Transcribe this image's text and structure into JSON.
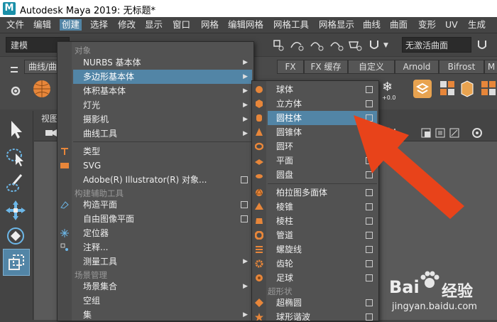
{
  "window": {
    "title": "Autodesk Maya 2019: 无标题*",
    "logo": "M"
  },
  "menubar": {
    "items": [
      "文件",
      "编辑",
      "创建",
      "选择",
      "修改",
      "显示",
      "窗口",
      "网格",
      "编辑网格",
      "网格工具",
      "网格显示",
      "曲线",
      "曲面",
      "变形",
      "UV",
      "生成"
    ],
    "active_index": 2
  },
  "shelf": {
    "mode_dropdown": "建模",
    "live_surface": "无激活曲面",
    "tabs": [
      "曲线/曲",
      "FX",
      "FX 缓存",
      "自定义",
      "Arnold",
      "Bifrost",
      "M"
    ]
  },
  "viewport": {
    "label": "视图"
  },
  "create_menu": {
    "sections": {
      "objects": "对象",
      "construction": "构建辅助工具",
      "scene": "场景管理"
    },
    "items": [
      {
        "label": "NURBS 基本体",
        "submenu": true
      },
      {
        "label": "多边形基本体",
        "submenu": true,
        "highlighted": true
      },
      {
        "label": "体积基本体",
        "submenu": true
      },
      {
        "label": "灯光",
        "submenu": true
      },
      {
        "label": "摄影机",
        "submenu": true
      },
      {
        "label": "曲线工具",
        "submenu": true
      },
      {
        "label": "类型"
      },
      {
        "label": "SVG"
      },
      {
        "label": "Adobe(R) Illustrator(R) 对象...",
        "option": true
      },
      {
        "label": "构造平面",
        "option": true
      },
      {
        "label": "自由图像平面",
        "option": true
      },
      {
        "label": "定位器"
      },
      {
        "label": "注释..."
      },
      {
        "label": "测量工具",
        "submenu": true
      },
      {
        "label": "场景集合",
        "submenu": true
      },
      {
        "label": "空组"
      },
      {
        "label": "集",
        "submenu": true
      }
    ]
  },
  "poly_menu": {
    "section_superellipse": "超形状",
    "items": [
      {
        "label": "球体",
        "icon": "sphere-icon"
      },
      {
        "label": "立方体",
        "icon": "cube-icon"
      },
      {
        "label": "圆柱体",
        "icon": "cylinder-icon",
        "highlighted": true
      },
      {
        "label": "圆锥体",
        "icon": "cone-icon"
      },
      {
        "label": "圆环",
        "icon": "torus-icon"
      },
      {
        "label": "平面",
        "icon": "plane-icon"
      },
      {
        "label": "圆盘",
        "icon": "disc-icon"
      },
      {
        "label": "柏拉图多面体",
        "icon": "platonic-icon"
      },
      {
        "label": "棱锥",
        "icon": "pyramid-icon"
      },
      {
        "label": "棱柱",
        "icon": "prism-icon"
      },
      {
        "label": "管道",
        "icon": "pipe-icon"
      },
      {
        "label": "螺旋线",
        "icon": "helix-icon"
      },
      {
        "label": "齿轮",
        "icon": "gear-icon"
      },
      {
        "label": "足球",
        "icon": "soccer-ball-icon"
      },
      {
        "label": "超椭圆",
        "icon": "superellipse-icon"
      },
      {
        "label": "球形谐波",
        "icon": "spherical-harmonics-icon"
      }
    ]
  },
  "watermark": {
    "brand": "Bai",
    "brand2": "经验",
    "url": "jingyan.baidu.com"
  },
  "colors": {
    "accent": "#5285a6",
    "arrow": "#e8431a"
  }
}
